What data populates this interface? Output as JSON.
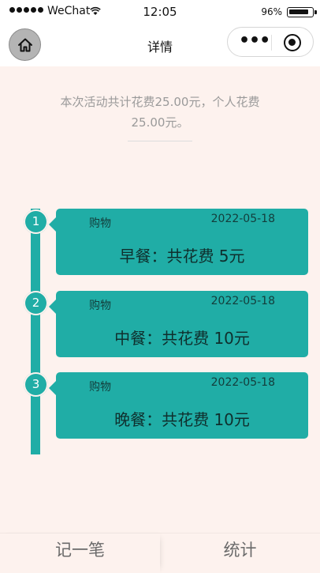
{
  "status_bar": {
    "carrier": "WeChat",
    "time": "12:05",
    "battery": "96%"
  },
  "nav": {
    "title": "详情",
    "more_label": "•••"
  },
  "summary": {
    "text": "本次活动共计花费25.00元，个人花费25.00元。"
  },
  "records": [
    {
      "index": "1",
      "category": "购物",
      "date": "2022-05-18",
      "description": "早餐：共花费 5元"
    },
    {
      "index": "2",
      "category": "购物",
      "date": "2022-05-18",
      "description": "中餐：共花费 10元"
    },
    {
      "index": "3",
      "category": "购物",
      "date": "2022-05-18",
      "description": "晚餐：共花费 10元"
    }
  ],
  "tab_bar": {
    "tabs": [
      {
        "label": "记一笔"
      },
      {
        "label": "统计"
      }
    ]
  },
  "colors": {
    "accent": "#20ada6",
    "page_background": "#fdf2ee"
  }
}
